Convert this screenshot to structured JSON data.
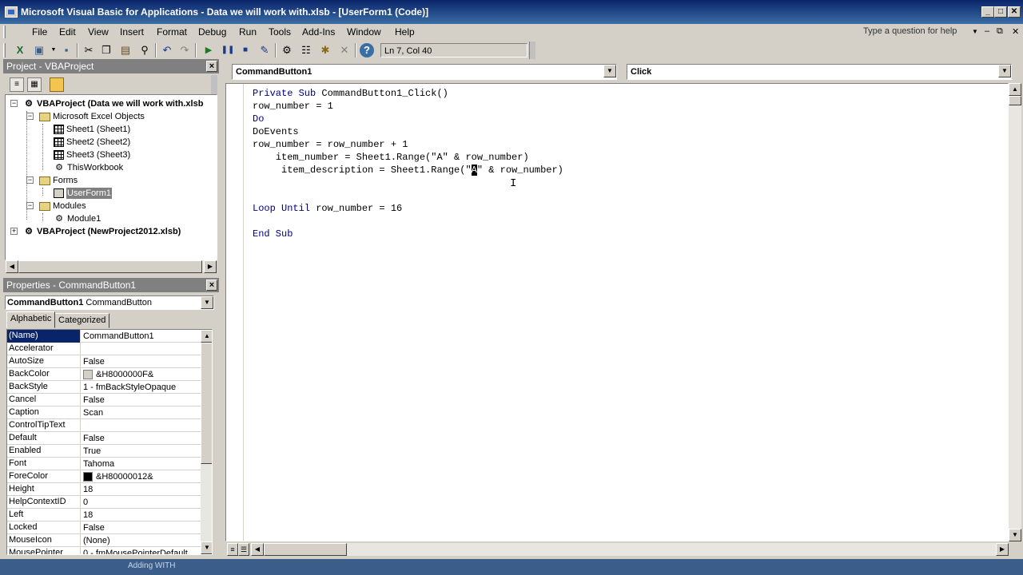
{
  "window": {
    "title": "Microsoft Visual Basic for Applications - Data we will work with.xlsb - [UserForm1 (Code)]",
    "min_glyph": "_",
    "max_glyph": "□",
    "close_glyph": "✕"
  },
  "menu": {
    "items": [
      "File",
      "Edit",
      "View",
      "Insert",
      "Format",
      "Debug",
      "Run",
      "Tools",
      "Add-Ins",
      "Window",
      "Help"
    ],
    "help_placeholder": "Type a question for help",
    "mdi_min": "–",
    "mdi_restore": "⧉",
    "mdi_close": "✕"
  },
  "toolbar": {
    "position": "Ln 7, Col 40",
    "icons": [
      "excel-view-icon",
      "insert-userform-icon",
      "save-icon",
      "cut-icon",
      "copy-icon",
      "paste-icon",
      "find-icon",
      "undo-icon",
      "redo-icon",
      "run-icon",
      "break-icon",
      "reset-icon",
      "design-mode-icon",
      "project-explorer-icon",
      "properties-window-icon",
      "object-browser-icon",
      "toolbox-icon",
      "help-icon"
    ]
  },
  "project": {
    "title": "Project - VBAProject",
    "tree": [
      {
        "label": "VBAProject (Data we will work with.xlsb",
        "bold": true
      },
      {
        "label": "Microsoft Excel Objects"
      },
      {
        "label": "Sheet1 (Sheet1)"
      },
      {
        "label": "Sheet2 (Sheet2)"
      },
      {
        "label": "Sheet3 (Sheet3)"
      },
      {
        "label": "ThisWorkbook"
      },
      {
        "label": "Forms"
      },
      {
        "label": "UserForm1",
        "selected": true
      },
      {
        "label": "Modules"
      },
      {
        "label": "Module1"
      },
      {
        "label": "VBAProject (NewProject2012.xlsb)",
        "bold": true
      }
    ]
  },
  "properties": {
    "title": "Properties - CommandButton1",
    "object_name": "CommandButton1",
    "object_type": "CommandButton",
    "tabs": [
      "Alphabetic",
      "Categorized"
    ],
    "rows": [
      {
        "name": "(Name)",
        "value": "CommandButton1"
      },
      {
        "name": "Accelerator",
        "value": ""
      },
      {
        "name": "AutoSize",
        "value": "False"
      },
      {
        "name": "BackColor",
        "value": "&H8000000F&",
        "swatch": "#d4d0c8"
      },
      {
        "name": "BackStyle",
        "value": "1 - fmBackStyleOpaque"
      },
      {
        "name": "Cancel",
        "value": "False"
      },
      {
        "name": "Caption",
        "value": "Scan"
      },
      {
        "name": "ControlTipText",
        "value": ""
      },
      {
        "name": "Default",
        "value": "False"
      },
      {
        "name": "Enabled",
        "value": "True"
      },
      {
        "name": "Font",
        "value": "Tahoma"
      },
      {
        "name": "ForeColor",
        "value": "&H80000012&",
        "swatch": "#000000"
      },
      {
        "name": "Height",
        "value": "18"
      },
      {
        "name": "HelpContextID",
        "value": "0"
      },
      {
        "name": "Left",
        "value": "18"
      },
      {
        "name": "Locked",
        "value": "False"
      },
      {
        "name": "MouseIcon",
        "value": "(None)"
      },
      {
        "name": "MousePointer",
        "value": "0 - fmMousePointerDefault"
      }
    ]
  },
  "code": {
    "object_combo": "CommandButton1",
    "procedure_combo": "Click",
    "lines": [
      {
        "indent": "",
        "segments": [
          {
            "t": "Private Sub ",
            "kw": true
          },
          {
            "t": "CommandButton1_Click()"
          }
        ]
      },
      {
        "indent": "",
        "segments": [
          {
            "t": "row_number = 1"
          }
        ]
      },
      {
        "indent": "",
        "segments": [
          {
            "t": "Do",
            "kw": true
          }
        ]
      },
      {
        "indent": "",
        "segments": [
          {
            "t": "DoEvents"
          }
        ]
      },
      {
        "indent": "",
        "segments": [
          {
            "t": "row_number = row_number + 1"
          }
        ]
      },
      {
        "indent": "    ",
        "segments": [
          {
            "t": "item_number = Sheet1.Range(\"A\" & row_number)"
          }
        ]
      },
      {
        "indent": "     ",
        "segments": [
          {
            "t": "item_description = Sheet1.Range(\""
          },
          {
            "t": "A",
            "sel": true
          },
          {
            "t": "\" & row_number)"
          }
        ]
      },
      {
        "indent": "",
        "segments": []
      },
      {
        "indent": "",
        "segments": []
      },
      {
        "indent": "",
        "segments": [
          {
            "t": "Loop Until ",
            "kw": true
          },
          {
            "t": "row_number = 16"
          }
        ]
      },
      {
        "indent": "",
        "segments": []
      },
      {
        "indent": "",
        "segments": [
          {
            "t": "End Sub",
            "kw": true
          }
        ]
      }
    ]
  },
  "taskbar": {
    "text": "Adding WITH"
  }
}
